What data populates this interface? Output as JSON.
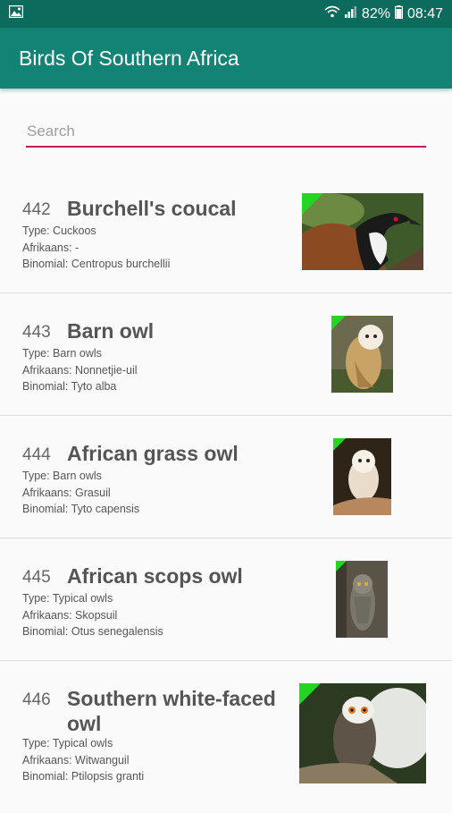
{
  "status": {
    "battery": "82%",
    "time": "08:47"
  },
  "app": {
    "title": "Birds Of Southern Africa"
  },
  "search": {
    "placeholder": "Search",
    "value": ""
  },
  "birds": [
    {
      "number": "442",
      "name": "Burchell's coucal",
      "type": "Type: Cuckoos",
      "afrikaans": "Afrikaans: -",
      "binomial": "Binomial: Centropus burchellii"
    },
    {
      "number": "443",
      "name": "Barn owl",
      "type": "Type: Barn owls",
      "afrikaans": "Afrikaans: Nonnetjie-uil",
      "binomial": "Binomial: Tyto alba"
    },
    {
      "number": "444",
      "name": "African grass owl",
      "type": "Type: Barn owls",
      "afrikaans": "Afrikaans: Grasuil",
      "binomial": "Binomial: Tyto capensis"
    },
    {
      "number": "445",
      "name": "African scops owl",
      "type": "Type: Typical owls",
      "afrikaans": "Afrikaans: Skopsuil",
      "binomial": "Binomial: Otus senegalensis"
    },
    {
      "number": "446",
      "name": "Southern white-faced owl",
      "type": "Type: Typical owls",
      "afrikaans": "Afrikaans: Witwanguil",
      "binomial": "Binomial: Ptilopsis granti"
    }
  ],
  "colors": {
    "statusbar": "#0d6b5e",
    "appbar": "#128374",
    "search_underline": "#c2185b",
    "thumbnail_corner": "#22d622"
  }
}
